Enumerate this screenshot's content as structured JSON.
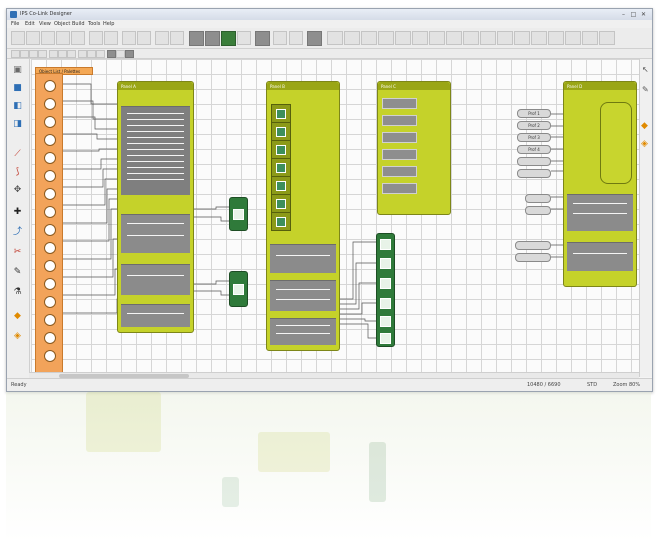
{
  "window": {
    "title": "IPS Co-Link Designer",
    "controls": [
      "–",
      "□",
      "✕"
    ]
  },
  "menu": [
    "File",
    "Edit",
    "View",
    "Object",
    "Build",
    "Tools",
    "Help"
  ],
  "palette_header": "Object List / Palettes",
  "panels": {
    "a_title": "Panel A",
    "b_title": "Panel B",
    "c_title": "Panel C",
    "d_title": "Panel D",
    "d_buttons": [
      "Prof 1",
      "Prof 2",
      "Prof 3",
      "Prof 4"
    ]
  },
  "status": {
    "left": "Ready",
    "coords": "10480 / 6690",
    "mode": "STD",
    "zoom": "Zoom 80%"
  },
  "colors": {
    "accent_green": "#2f7a3a",
    "panel_yellow": "#c5d22a",
    "palette_orange": "#f2a35a"
  }
}
